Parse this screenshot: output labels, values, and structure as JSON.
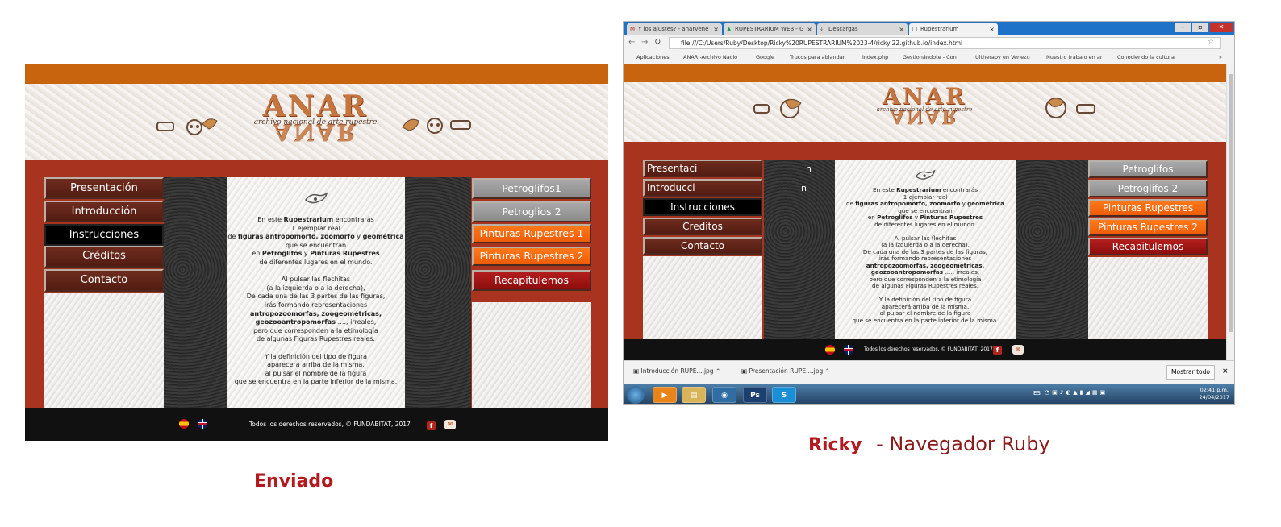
{
  "site": {
    "logo_text": "ANAR",
    "logo_subtitle": "archivo nacional de arte rupestre",
    "menu_left": [
      "Presentación",
      "Introducción",
      "Instrucciones",
      "Créditos",
      "Contacto"
    ],
    "menu_right": [
      "Petroglifos1",
      "Petroglios 2",
      "Pinturas Rupestres 1",
      "Pinturas Rupestres 2",
      "Recapitulemos"
    ],
    "content_lines": [
      [
        "En este ",
        "Rupestrarium",
        " encontrarás"
      ],
      [
        "1 ejemplar real"
      ],
      [
        "de ",
        "figuras antropomorfo, zoomorfo",
        " y ",
        "geométrica"
      ],
      [
        "que se encuentran"
      ],
      [
        "en ",
        "Petroglifos",
        " y ",
        "Pinturas Rupestres"
      ],
      [
        "de diferentes lugares en el mundo."
      ],
      [
        ""
      ],
      [
        "Al pulsar las flechitas"
      ],
      [
        "(a la izquierda o a la derecha),"
      ],
      [
        "De cada una de las 3 partes de las figuras,"
      ],
      [
        "irás formando representaciones"
      ],
      [
        "antropozoomorfas, zoogeométricas,"
      ],
      [
        "geozooantropomorfas",
        " …., irreales,"
      ],
      [
        "pero que corresponden a la etimología"
      ],
      [
        "de algunas Figuras Rupestres reales."
      ],
      [
        ""
      ],
      [
        "Y la definición del tipo de figura"
      ],
      [
        "aparecerá arriba de la misma,"
      ],
      [
        "al pulsar el nombre de la figura"
      ],
      [
        "que se encuentra en la parte inferior de la misma."
      ]
    ],
    "footer_text": "Todos los derechos reservados, © FUNDABITAT, 2017",
    "facebook_icon": "facebook-icon",
    "mail_icon": "mail-icon"
  },
  "site_right": {
    "menu_left": [
      "Presentaci",
      "Introducci",
      "Instrucciones",
      "Creditos",
      "Contacto"
    ],
    "menu_left_overflow": [
      "n",
      "n"
    ],
    "menu_right": [
      "Petroglifos",
      "Petroglifos 2",
      "Pinturas Rupestres",
      "Pinturas Rupestres 2",
      "Recapitulemos"
    ]
  },
  "captions": {
    "left": "Enviado",
    "right_name": "Ricky",
    "right_rest": "- Navegador Ruby"
  },
  "browser": {
    "tabs": [
      "Y los ajustes? - anarvene",
      "RUPESTRARIUM WEB - G",
      "Descargas",
      "Rupestrarium"
    ],
    "url": "file:///C:/Users/Ruby/Desktop/Ricky%20RUPESTRARIUM%2023-4/rickyl22.github.io/index.html",
    "bookmarks": [
      "Aplicaciones",
      "ANAR -Archivo Nacio",
      "Google",
      "Trucos para ablandar",
      "index.php",
      "Gestionándote - Con",
      "Ultherapy en Venezu",
      "Nuestro trabajo en ar",
      "Conociendo la cultura"
    ],
    "bookmarks_more": "»",
    "downloads": [
      "Introducción RUPE....jpg",
      "Presentación RUPE....jpg"
    ],
    "show_all": "Mostrar todo",
    "close": "×",
    "tray_lang": "ES",
    "clock_time": "02:41 p.m.",
    "clock_date": "24/04/2017",
    "taskbar_apps": [
      "Ps",
      "S"
    ]
  },
  "colors": {
    "topbar": "#c8640e",
    "redfield": "#a8331f",
    "caption_red": "#b3191e",
    "caption_dark": "#8c1a1a"
  }
}
